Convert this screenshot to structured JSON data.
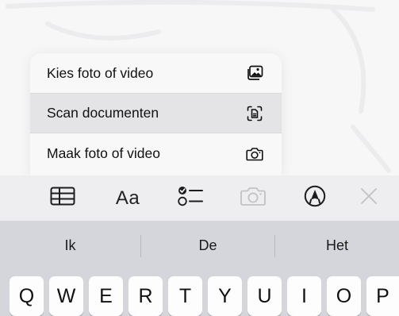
{
  "menu": {
    "items": [
      {
        "label": "Kies foto of video",
        "icon": "photo-library-icon"
      },
      {
        "label": "Scan documenten",
        "icon": "scan-document-icon"
      },
      {
        "label": "Maak foto of video",
        "icon": "camera-icon"
      }
    ],
    "highlighted_index": 1
  },
  "toolbar": {
    "format_label": "Aa",
    "tools": [
      "table-icon",
      "text-format",
      "checklist-icon",
      "camera-icon",
      "markup-icon",
      "close-icon"
    ]
  },
  "keyboard": {
    "predictions": [
      "Ik",
      "De",
      "Het"
    ],
    "keys_row1": [
      "Q",
      "W",
      "E",
      "R",
      "T",
      "Y",
      "U",
      "I",
      "O",
      "P"
    ]
  },
  "colors": {
    "toolbar_bg": "#eeeef0",
    "keyboard_bg": "#d4d6dc",
    "highlight": "#e4e4e6",
    "disabled_icon": "#c2c2c6"
  }
}
